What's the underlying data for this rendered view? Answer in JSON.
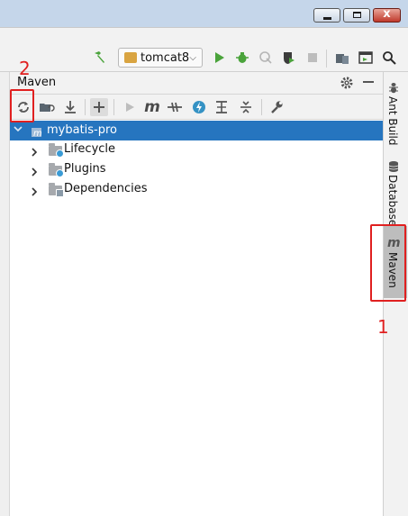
{
  "window": {
    "minimize_glyph": "",
    "close_glyph": "x"
  },
  "toolbar": {
    "run_config": "tomcat8",
    "run_config_dropdown_glyph": "⌵",
    "icons": [
      "build-hammer-icon",
      "run-icon",
      "debug-icon",
      "coverage-icon",
      "profile-icon",
      "stop-icon",
      "project-structure-icon",
      "run-anything-icon",
      "search-icon"
    ]
  },
  "maven_panel": {
    "title": "Maven",
    "tools": [
      "reload-icon",
      "generate-sources-icon",
      "download-icon",
      "add-icon",
      "run-icon",
      "execute-goal-icon",
      "toggle-offline-icon",
      "skip-tests-icon",
      "show-dependencies-icon",
      "collapse-all-icon",
      "settings-icon"
    ]
  },
  "tree": {
    "root": "mybatis-pro",
    "children": [
      "Lifecycle",
      "Plugins",
      "Dependencies"
    ]
  },
  "side_strip": {
    "tabs": [
      "Ant Build",
      "Database",
      "Maven"
    ]
  },
  "annotations": {
    "label_1": "1",
    "label_2": "2"
  },
  "colors": {
    "selection": "#2675bf",
    "annotation_red": "#e02020",
    "run_green": "#4aa33b"
  }
}
